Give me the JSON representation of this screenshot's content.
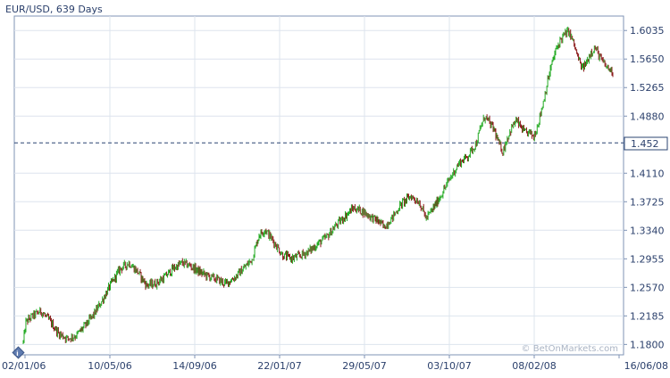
{
  "chart_data": {
    "type": "candlestick",
    "title": "EUR/USD, 639 Days",
    "watermark": "© BetOnMarkets.com",
    "x_tick_labels": [
      "02/01/06",
      "10/05/06",
      "14/09/06",
      "22/01/07",
      "29/05/07",
      "03/10/07",
      "08/02/08",
      "16/06/08"
    ],
    "y_tick_labels": [
      "1.1800",
      "1.2185",
      "1.2570",
      "1.2955",
      "1.3340",
      "1.3725",
      "1.4110",
      "1.4880",
      "1.5265",
      "1.5650",
      "1.6035"
    ],
    "ylim": [
      1.166,
      1.623
    ],
    "reference_line": {
      "value": 1.452,
      "label": "1.452"
    },
    "series_key_points": [
      [
        0,
        1.183
      ],
      [
        3,
        1.21
      ],
      [
        10,
        1.218
      ],
      [
        20,
        1.225
      ],
      [
        30,
        1.212
      ],
      [
        40,
        1.195
      ],
      [
        50,
        1.188
      ],
      [
        60,
        1.192
      ],
      [
        70,
        1.205
      ],
      [
        80,
        1.22
      ],
      [
        90,
        1.24
      ],
      [
        100,
        1.262
      ],
      [
        110,
        1.282
      ],
      [
        120,
        1.29
      ],
      [
        130,
        1.278
      ],
      [
        140,
        1.26
      ],
      [
        150,
        1.262
      ],
      [
        160,
        1.27
      ],
      [
        170,
        1.282
      ],
      [
        180,
        1.29
      ],
      [
        190,
        1.286
      ],
      [
        200,
        1.278
      ],
      [
        210,
        1.272
      ],
      [
        220,
        1.268
      ],
      [
        230,
        1.262
      ],
      [
        240,
        1.27
      ],
      [
        250,
        1.282
      ],
      [
        260,
        1.295
      ],
      [
        268,
        1.328
      ],
      [
        275,
        1.335
      ],
      [
        285,
        1.318
      ],
      [
        295,
        1.3
      ],
      [
        305,
        1.296
      ],
      [
        315,
        1.3
      ],
      [
        325,
        1.306
      ],
      [
        335,
        1.316
      ],
      [
        345,
        1.325
      ],
      [
        355,
        1.34
      ],
      [
        365,
        1.352
      ],
      [
        375,
        1.364
      ],
      [
        385,
        1.36
      ],
      [
        395,
        1.352
      ],
      [
        405,
        1.345
      ],
      [
        410,
        1.338
      ],
      [
        420,
        1.352
      ],
      [
        430,
        1.37
      ],
      [
        440,
        1.38
      ],
      [
        450,
        1.372
      ],
      [
        458,
        1.35
      ],
      [
        465,
        1.362
      ],
      [
        475,
        1.382
      ],
      [
        485,
        1.404
      ],
      [
        495,
        1.424
      ],
      [
        505,
        1.434
      ],
      [
        515,
        1.452
      ],
      [
        520,
        1.474
      ],
      [
        525,
        1.488
      ],
      [
        530,
        1.478
      ],
      [
        535,
        1.47
      ],
      [
        540,
        1.452
      ],
      [
        545,
        1.44
      ],
      [
        550,
        1.458
      ],
      [
        555,
        1.472
      ],
      [
        560,
        1.482
      ],
      [
        565,
        1.474
      ],
      [
        570,
        1.465
      ],
      [
        575,
        1.466
      ],
      [
        580,
        1.46
      ],
      [
        585,
        1.478
      ],
      [
        590,
        1.502
      ],
      [
        595,
        1.53
      ],
      [
        600,
        1.556
      ],
      [
        605,
        1.576
      ],
      [
        610,
        1.59
      ],
      [
        615,
        1.598
      ],
      [
        620,
        1.602
      ],
      [
        625,
        1.588
      ],
      [
        630,
        1.568
      ],
      [
        635,
        1.552
      ],
      [
        640,
        1.56
      ],
      [
        645,
        1.575
      ],
      [
        650,
        1.58
      ],
      [
        655,
        1.568
      ],
      [
        660,
        1.558
      ],
      [
        665,
        1.552
      ],
      [
        670,
        1.548
      ]
    ],
    "colors": {
      "up": "#22aa22",
      "down": "#8b1a1a",
      "frame": "#7f93b5",
      "grid": "#dde4ee",
      "label": "#2a3f6b",
      "reference": "#2b4472"
    },
    "grid": true
  }
}
